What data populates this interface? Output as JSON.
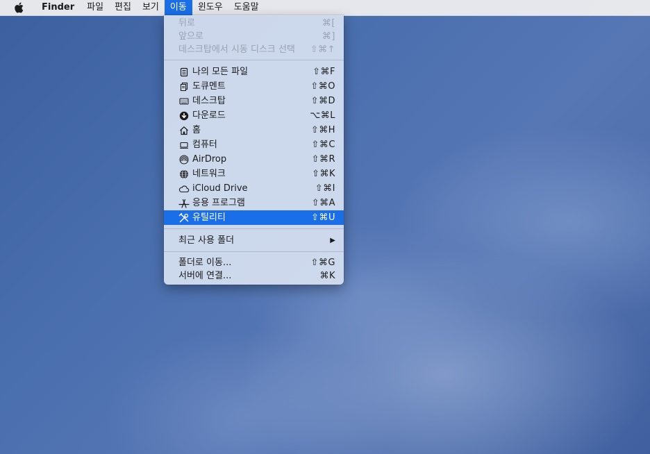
{
  "menubar": {
    "app_name": "Finder",
    "menus": [
      "파일",
      "편집",
      "보기",
      "이동",
      "윈도우",
      "도움말"
    ],
    "active_menu": "이동"
  },
  "go_menu": {
    "history": [
      {
        "label": "뒤로",
        "shortcut": "⌘[",
        "enabled": false
      },
      {
        "label": "앞으로",
        "shortcut": "⌘]",
        "enabled": false
      },
      {
        "label": "데스크탑에서 시동 디스크 선택",
        "shortcut": "⇧⌘↑",
        "enabled": false
      }
    ],
    "places": [
      {
        "label": "나의 모든 파일",
        "shortcut": "⇧⌘F",
        "icon": "all-files-icon"
      },
      {
        "label": "도큐멘트",
        "shortcut": "⇧⌘O",
        "icon": "documents-icon"
      },
      {
        "label": "데스크탑",
        "shortcut": "⇧⌘D",
        "icon": "desktop-icon"
      },
      {
        "label": "다운로드",
        "shortcut": "⌥⌘L",
        "icon": "downloads-icon"
      },
      {
        "label": "홈",
        "shortcut": "⇧⌘H",
        "icon": "home-icon"
      },
      {
        "label": "컴퓨터",
        "shortcut": "⇧⌘C",
        "icon": "computer-icon"
      },
      {
        "label": "AirDrop",
        "shortcut": "⇧⌘R",
        "icon": "airdrop-icon"
      },
      {
        "label": "네트워크",
        "shortcut": "⇧⌘K",
        "icon": "network-icon"
      },
      {
        "label": "iCloud Drive",
        "shortcut": "⇧⌘I",
        "icon": "icloud-icon"
      },
      {
        "label": "응용 프로그램",
        "shortcut": "⇧⌘A",
        "icon": "applications-icon"
      },
      {
        "label": "유틸리티",
        "shortcut": "⇧⌘U",
        "icon": "utilities-icon",
        "highlighted": true
      }
    ],
    "recent": {
      "label": "최근 사용 폴더",
      "arrow": "▶"
    },
    "connect": [
      {
        "label": "폴더로 이동...",
        "shortcut": "⇧⌘G"
      },
      {
        "label": "서버에 연결...",
        "shortcut": "⌘K"
      }
    ]
  },
  "colors": {
    "highlight": "#1a6fe8",
    "disabled_text": "#9aa3b4",
    "desktop": "#4a6fae"
  }
}
